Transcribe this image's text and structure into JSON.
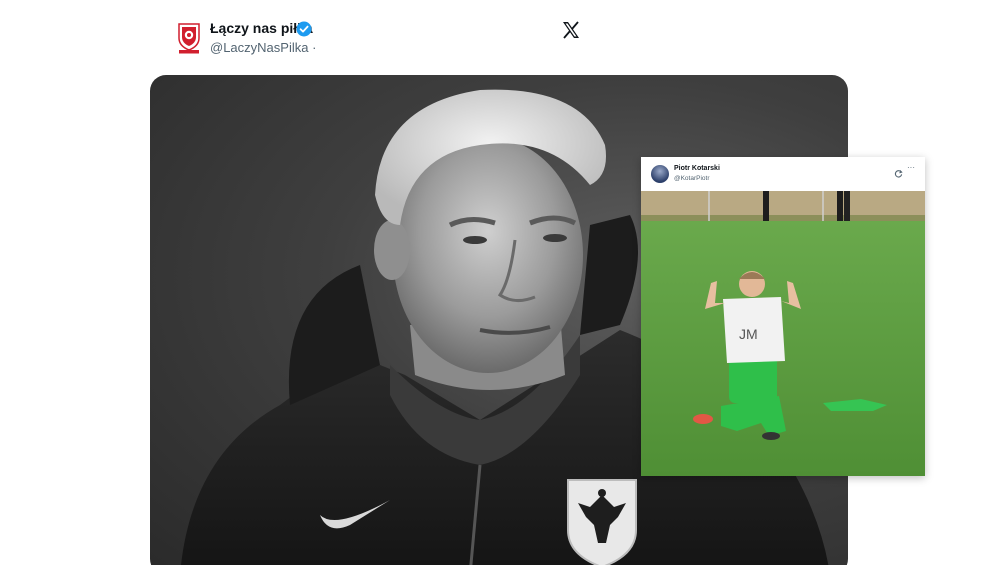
{
  "tweet": {
    "author_name": "Łączy nas piłka",
    "author_handle": "@LaczyNasPilka ·",
    "verified": true,
    "avatar_icon": "pzpn-logo-icon",
    "close_icon": "x-logo-icon"
  },
  "media": {
    "main_photo_icon": "coach-portrait-photo",
    "crest_icon": "polish-eagle-crest-icon",
    "brand_icon": "nike-swoosh-icon"
  },
  "embedded_tweet": {
    "author_name": "Piotr Kotarski",
    "author_handle": "@KotarPiotr",
    "refresh_icon": "refresh-icon",
    "more_icon": "more-options-icon",
    "more_label": "···",
    "shirt_text": "JM",
    "video_icon": "player-kneeling-video"
  },
  "colors": {
    "verified_blue": "#1d9bf0",
    "pitch_green": "#4f9a3a",
    "shorts_green": "#2fbf4a"
  }
}
